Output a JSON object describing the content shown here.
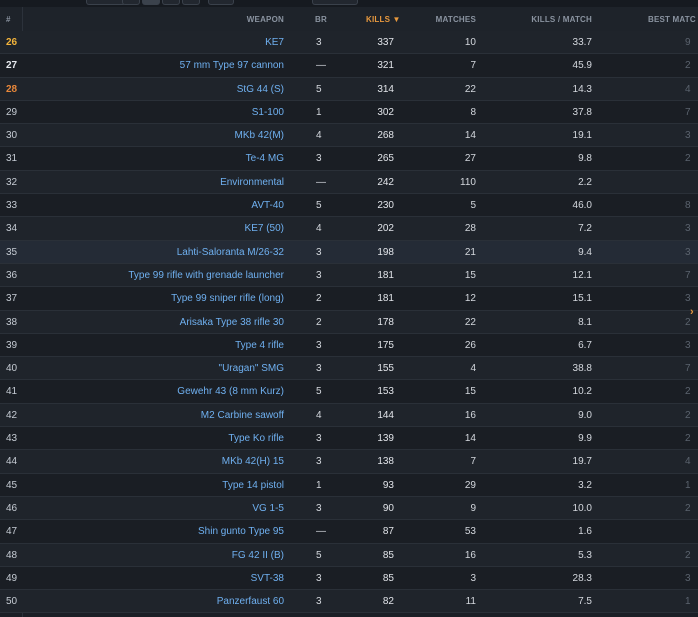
{
  "table": {
    "headers": {
      "rank": "#",
      "weapon": "WEAPON",
      "br": "BR",
      "kills": "KILLS ▼",
      "matches": "MATCHES",
      "kills_per_match": "KILLS / MATCH",
      "best_match": "BEST MATC"
    },
    "rows": [
      {
        "rank": "26",
        "weapon": "KE7",
        "br": "3",
        "kills": "337",
        "matches": "10",
        "kpm": "33.7",
        "best": "9"
      },
      {
        "rank": "27",
        "weapon": "57 mm Type 97 cannon",
        "br": "—",
        "kills": "321",
        "matches": "7",
        "kpm": "45.9",
        "best": "2"
      },
      {
        "rank": "28",
        "weapon": "StG 44 (S)",
        "br": "5",
        "kills": "314",
        "matches": "22",
        "kpm": "14.3",
        "best": "4"
      },
      {
        "rank": "29",
        "weapon": "S1-100",
        "br": "1",
        "kills": "302",
        "matches": "8",
        "kpm": "37.8",
        "best": "7"
      },
      {
        "rank": "30",
        "weapon": "MKb 42(M)",
        "br": "4",
        "kills": "268",
        "matches": "14",
        "kpm": "19.1",
        "best": "3"
      },
      {
        "rank": "31",
        "weapon": "Te-4 MG",
        "br": "3",
        "kills": "265",
        "matches": "27",
        "kpm": "9.8",
        "best": "2"
      },
      {
        "rank": "32",
        "weapon": "Environmental",
        "br": "—",
        "kills": "242",
        "matches": "110",
        "kpm": "2.2",
        "best": ""
      },
      {
        "rank": "33",
        "weapon": "AVT-40",
        "br": "5",
        "kills": "230",
        "matches": "5",
        "kpm": "46.0",
        "best": "8"
      },
      {
        "rank": "34",
        "weapon": "KE7 (50)",
        "br": "4",
        "kills": "202",
        "matches": "28",
        "kpm": "7.2",
        "best": "3"
      },
      {
        "rank": "35",
        "weapon": "Lahti-Saloranta M/26-32",
        "br": "3",
        "kills": "198",
        "matches": "21",
        "kpm": "9.4",
        "best": "3"
      },
      {
        "rank": "36",
        "weapon": "Type 99 rifle with grenade launcher",
        "br": "3",
        "kills": "181",
        "matches": "15",
        "kpm": "12.1",
        "best": "7"
      },
      {
        "rank": "37",
        "weapon": "Type 99 sniper rifle (long)",
        "br": "2",
        "kills": "181",
        "matches": "12",
        "kpm": "15.1",
        "best": "3"
      },
      {
        "rank": "38",
        "weapon": "Arisaka Type 38 rifle 30",
        "br": "2",
        "kills": "178",
        "matches": "22",
        "kpm": "8.1",
        "best": "2"
      },
      {
        "rank": "39",
        "weapon": "Type 4 rifle",
        "br": "3",
        "kills": "175",
        "matches": "26",
        "kpm": "6.7",
        "best": "3"
      },
      {
        "rank": "40",
        "weapon": "\"Uragan\" SMG",
        "br": "3",
        "kills": "155",
        "matches": "4",
        "kpm": "38.8",
        "best": "7"
      },
      {
        "rank": "41",
        "weapon": "Gewehr 43 (8 mm Kurz)",
        "br": "5",
        "kills": "153",
        "matches": "15",
        "kpm": "10.2",
        "best": "2"
      },
      {
        "rank": "42",
        "weapon": "M2 Carbine sawoff",
        "br": "4",
        "kills": "144",
        "matches": "16",
        "kpm": "9.0",
        "best": "2"
      },
      {
        "rank": "43",
        "weapon": "Type Ko rifle",
        "br": "3",
        "kills": "139",
        "matches": "14",
        "kpm": "9.9",
        "best": "2"
      },
      {
        "rank": "44",
        "weapon": "MKb 42(H) 15",
        "br": "3",
        "kills": "138",
        "matches": "7",
        "kpm": "19.7",
        "best": "4"
      },
      {
        "rank": "45",
        "weapon": "Type 14 pistol",
        "br": "1",
        "kills": "93",
        "matches": "29",
        "kpm": "3.2",
        "best": "1"
      },
      {
        "rank": "46",
        "weapon": "VG 1-5",
        "br": "3",
        "kills": "90",
        "matches": "9",
        "kpm": "10.0",
        "best": "2"
      },
      {
        "rank": "47",
        "weapon": "Shin gunto Type 95",
        "br": "—",
        "kills": "87",
        "matches": "53",
        "kpm": "1.6",
        "best": ""
      },
      {
        "rank": "48",
        "weapon": "FG 42 II (B)",
        "br": "5",
        "kills": "85",
        "matches": "16",
        "kpm": "5.3",
        "best": "2"
      },
      {
        "rank": "49",
        "weapon": "SVT-38",
        "br": "3",
        "kills": "85",
        "matches": "3",
        "kpm": "28.3",
        "best": "3"
      },
      {
        "rank": "50",
        "weapon": "Panzerfaust 60",
        "br": "3",
        "kills": "82",
        "matches": "11",
        "kpm": "7.5",
        "best": "1"
      }
    ]
  },
  "colors": {
    "accent": "#e8993e",
    "link": "#6fb0f0",
    "gold": "#f3b43b",
    "bronze": "#e8873a"
  },
  "icons": {
    "scroll_right": "chevron-right-icon"
  }
}
